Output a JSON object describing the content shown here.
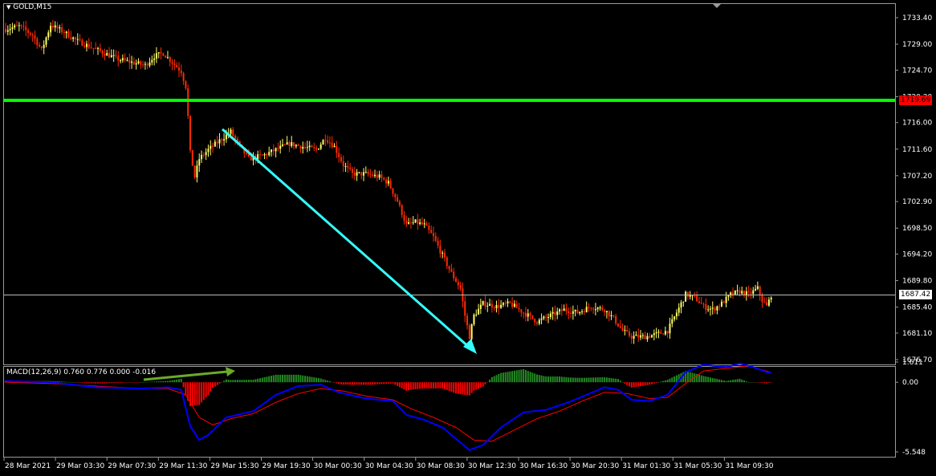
{
  "window": {
    "title": "GOLD,M15",
    "dropdown_icon": "triangle-down-icon"
  },
  "colors": {
    "background": "#000000",
    "bull_candle": "#ffff66",
    "bear_candle": "#ff2a00",
    "support_line": "#00ff00",
    "trend_arrow": "#33ffff",
    "macd_line": "#0000ff",
    "signal_line": "#ff0000",
    "hist_positive": "#228b22",
    "hist_negative": "#ff0000",
    "annotation_arrow": "#6aaa2a"
  },
  "price_axis": {
    "ticks": [
      "1733.40",
      "1729.00",
      "1724.70",
      "1720.30",
      "1716.00",
      "1711.60",
      "1707.20",
      "1702.90",
      "1698.50",
      "1694.20",
      "1689.80",
      "1685.40",
      "1681.10",
      "1676.70"
    ],
    "range": [
      1676.7,
      1733.4
    ]
  },
  "support_level": {
    "price": 1719.69,
    "label": "1719.69"
  },
  "current_price": {
    "price": 1687.42,
    "label": "1687.42"
  },
  "macd": {
    "title": "MACD(12,26,9) 0.760 0.776 0.000 -0.016",
    "ticks": [
      "1.611",
      "0.00",
      "-5.548"
    ],
    "range": [
      -5.548,
      1.611
    ]
  },
  "time_axis": {
    "labels": [
      "28 Mar 2021",
      "29 Mar 03:30",
      "29 Mar 07:30",
      "29 Mar 11:30",
      "29 Mar 15:30",
      "29 Mar 19:30",
      "30 Mar 00:30",
      "30 Mar 04:30",
      "30 Mar 08:30",
      "30 Mar 12:30",
      "30 Mar 16:30",
      "30 Mar 20:30",
      "31 Mar 01:30",
      "31 Mar 05:30",
      "31 Mar 09:30"
    ]
  },
  "chart_data": {
    "type": "candlestick",
    "symbol": "GOLD",
    "timeframe": "M15",
    "close_path": [
      [
        0,
        1731.5
      ],
      [
        6,
        1732.0
      ],
      [
        12,
        1730.5
      ],
      [
        16,
        1728.0
      ],
      [
        20,
        1732.2
      ],
      [
        26,
        1731.0
      ],
      [
        32,
        1729.5
      ],
      [
        38,
        1728.5
      ],
      [
        44,
        1727.5
      ],
      [
        50,
        1726.5
      ],
      [
        56,
        1726.0
      ],
      [
        62,
        1725.5
      ],
      [
        66,
        1727.0
      ],
      [
        70,
        1727.5
      ],
      [
        74,
        1726.0
      ],
      [
        78,
        1724.5
      ],
      [
        80,
        1722.0
      ],
      [
        81,
        1717.0
      ],
      [
        82,
        1711.0
      ],
      [
        84,
        1707.0
      ],
      [
        86,
        1710.0
      ],
      [
        90,
        1711.5
      ],
      [
        95,
        1713.0
      ],
      [
        100,
        1714.5
      ],
      [
        104,
        1712.0
      ],
      [
        108,
        1710.0
      ],
      [
        114,
        1710.5
      ],
      [
        120,
        1711.5
      ],
      [
        126,
        1712.5
      ],
      [
        132,
        1712.0
      ],
      [
        138,
        1711.5
      ],
      [
        142,
        1713.5
      ],
      [
        146,
        1712.0
      ],
      [
        150,
        1709.0
      ],
      [
        154,
        1707.5
      ],
      [
        160,
        1707.5
      ],
      [
        166,
        1707.0
      ],
      [
        170,
        1706.0
      ],
      [
        174,
        1703.0
      ],
      [
        178,
        1699.0
      ],
      [
        182,
        1699.5
      ],
      [
        186,
        1699.0
      ],
      [
        190,
        1697.0
      ],
      [
        194,
        1694.0
      ],
      [
        198,
        1691.0
      ],
      [
        202,
        1688.5
      ],
      [
        204,
        1684.0
      ],
      [
        206,
        1680.5
      ],
      [
        208,
        1684.0
      ],
      [
        212,
        1686.0
      ],
      [
        218,
        1685.5
      ],
      [
        224,
        1686.0
      ],
      [
        230,
        1684.5
      ],
      [
        236,
        1683.0
      ],
      [
        242,
        1684.0
      ],
      [
        248,
        1685.0
      ],
      [
        254,
        1684.5
      ],
      [
        260,
        1685.5
      ],
      [
        266,
        1685.0
      ],
      [
        270,
        1683.5
      ],
      [
        274,
        1681.5
      ],
      [
        278,
        1680.5
      ],
      [
        284,
        1680.5
      ],
      [
        290,
        1681.0
      ],
      [
        294,
        1681.5
      ],
      [
        298,
        1684.5
      ],
      [
        302,
        1687.5
      ],
      [
        306,
        1687.0
      ],
      [
        310,
        1685.5
      ],
      [
        314,
        1685.0
      ],
      [
        318,
        1686.0
      ],
      [
        322,
        1687.5
      ],
      [
        326,
        1688.0
      ],
      [
        330,
        1687.5
      ],
      [
        334,
        1688.5
      ],
      [
        336,
        1686.5
      ],
      [
        338,
        1685.5
      ],
      [
        340,
        1687.4
      ]
    ],
    "macd_path": [
      [
        0,
        0.1
      ],
      [
        20,
        0.0
      ],
      [
        40,
        -0.4
      ],
      [
        60,
        -0.5
      ],
      [
        72,
        -0.4
      ],
      [
        78,
        -0.6
      ],
      [
        82,
        -3.5
      ],
      [
        86,
        -4.6
      ],
      [
        90,
        -4.2
      ],
      [
        98,
        -2.8
      ],
      [
        110,
        -2.3
      ],
      [
        120,
        -1.0
      ],
      [
        130,
        -0.3
      ],
      [
        140,
        -0.2
      ],
      [
        148,
        -0.8
      ],
      [
        160,
        -1.3
      ],
      [
        172,
        -1.5
      ],
      [
        178,
        -2.6
      ],
      [
        186,
        -3.0
      ],
      [
        194,
        -3.6
      ],
      [
        200,
        -4.5
      ],
      [
        206,
        -5.4
      ],
      [
        212,
        -5.0
      ],
      [
        220,
        -3.6
      ],
      [
        230,
        -2.4
      ],
      [
        240,
        -2.2
      ],
      [
        250,
        -1.6
      ],
      [
        258,
        -1.0
      ],
      [
        266,
        -0.4
      ],
      [
        272,
        -0.6
      ],
      [
        278,
        -1.4
      ],
      [
        286,
        -1.5
      ],
      [
        294,
        -1.0
      ],
      [
        302,
        0.8
      ],
      [
        310,
        1.4
      ],
      [
        320,
        1.2
      ],
      [
        326,
        1.5
      ],
      [
        332,
        1.2
      ],
      [
        338,
        0.8
      ],
      [
        340,
        0.76
      ]
    ],
    "signal_path": [
      [
        0,
        0.0
      ],
      [
        20,
        -0.1
      ],
      [
        40,
        -0.3
      ],
      [
        60,
        -0.5
      ],
      [
        72,
        -0.5
      ],
      [
        80,
        -1.0
      ],
      [
        86,
        -2.8
      ],
      [
        92,
        -3.4
      ],
      [
        100,
        -2.9
      ],
      [
        110,
        -2.5
      ],
      [
        120,
        -1.6
      ],
      [
        130,
        -0.9
      ],
      [
        140,
        -0.5
      ],
      [
        150,
        -0.7
      ],
      [
        160,
        -1.1
      ],
      [
        172,
        -1.4
      ],
      [
        180,
        -2.1
      ],
      [
        190,
        -2.8
      ],
      [
        200,
        -3.6
      ],
      [
        208,
        -4.6
      ],
      [
        216,
        -4.7
      ],
      [
        226,
        -3.8
      ],
      [
        236,
        -2.9
      ],
      [
        246,
        -2.3
      ],
      [
        256,
        -1.5
      ],
      [
        266,
        -0.8
      ],
      [
        276,
        -0.9
      ],
      [
        286,
        -1.3
      ],
      [
        294,
        -1.2
      ],
      [
        302,
        -0.1
      ],
      [
        310,
        0.9
      ],
      [
        320,
        1.1
      ],
      [
        330,
        1.3
      ],
      [
        340,
        0.776
      ]
    ],
    "annotations": [
      {
        "type": "trend-arrow",
        "from": [
          "29 Mar 14:30",
          1714.5
        ],
        "to": [
          "30 Mar 11:45",
          1678.5
        ]
      },
      {
        "type": "horizontal-line",
        "price": 1719.69
      },
      {
        "type": "macd-divergence-arrow",
        "direction": "up"
      }
    ]
  }
}
